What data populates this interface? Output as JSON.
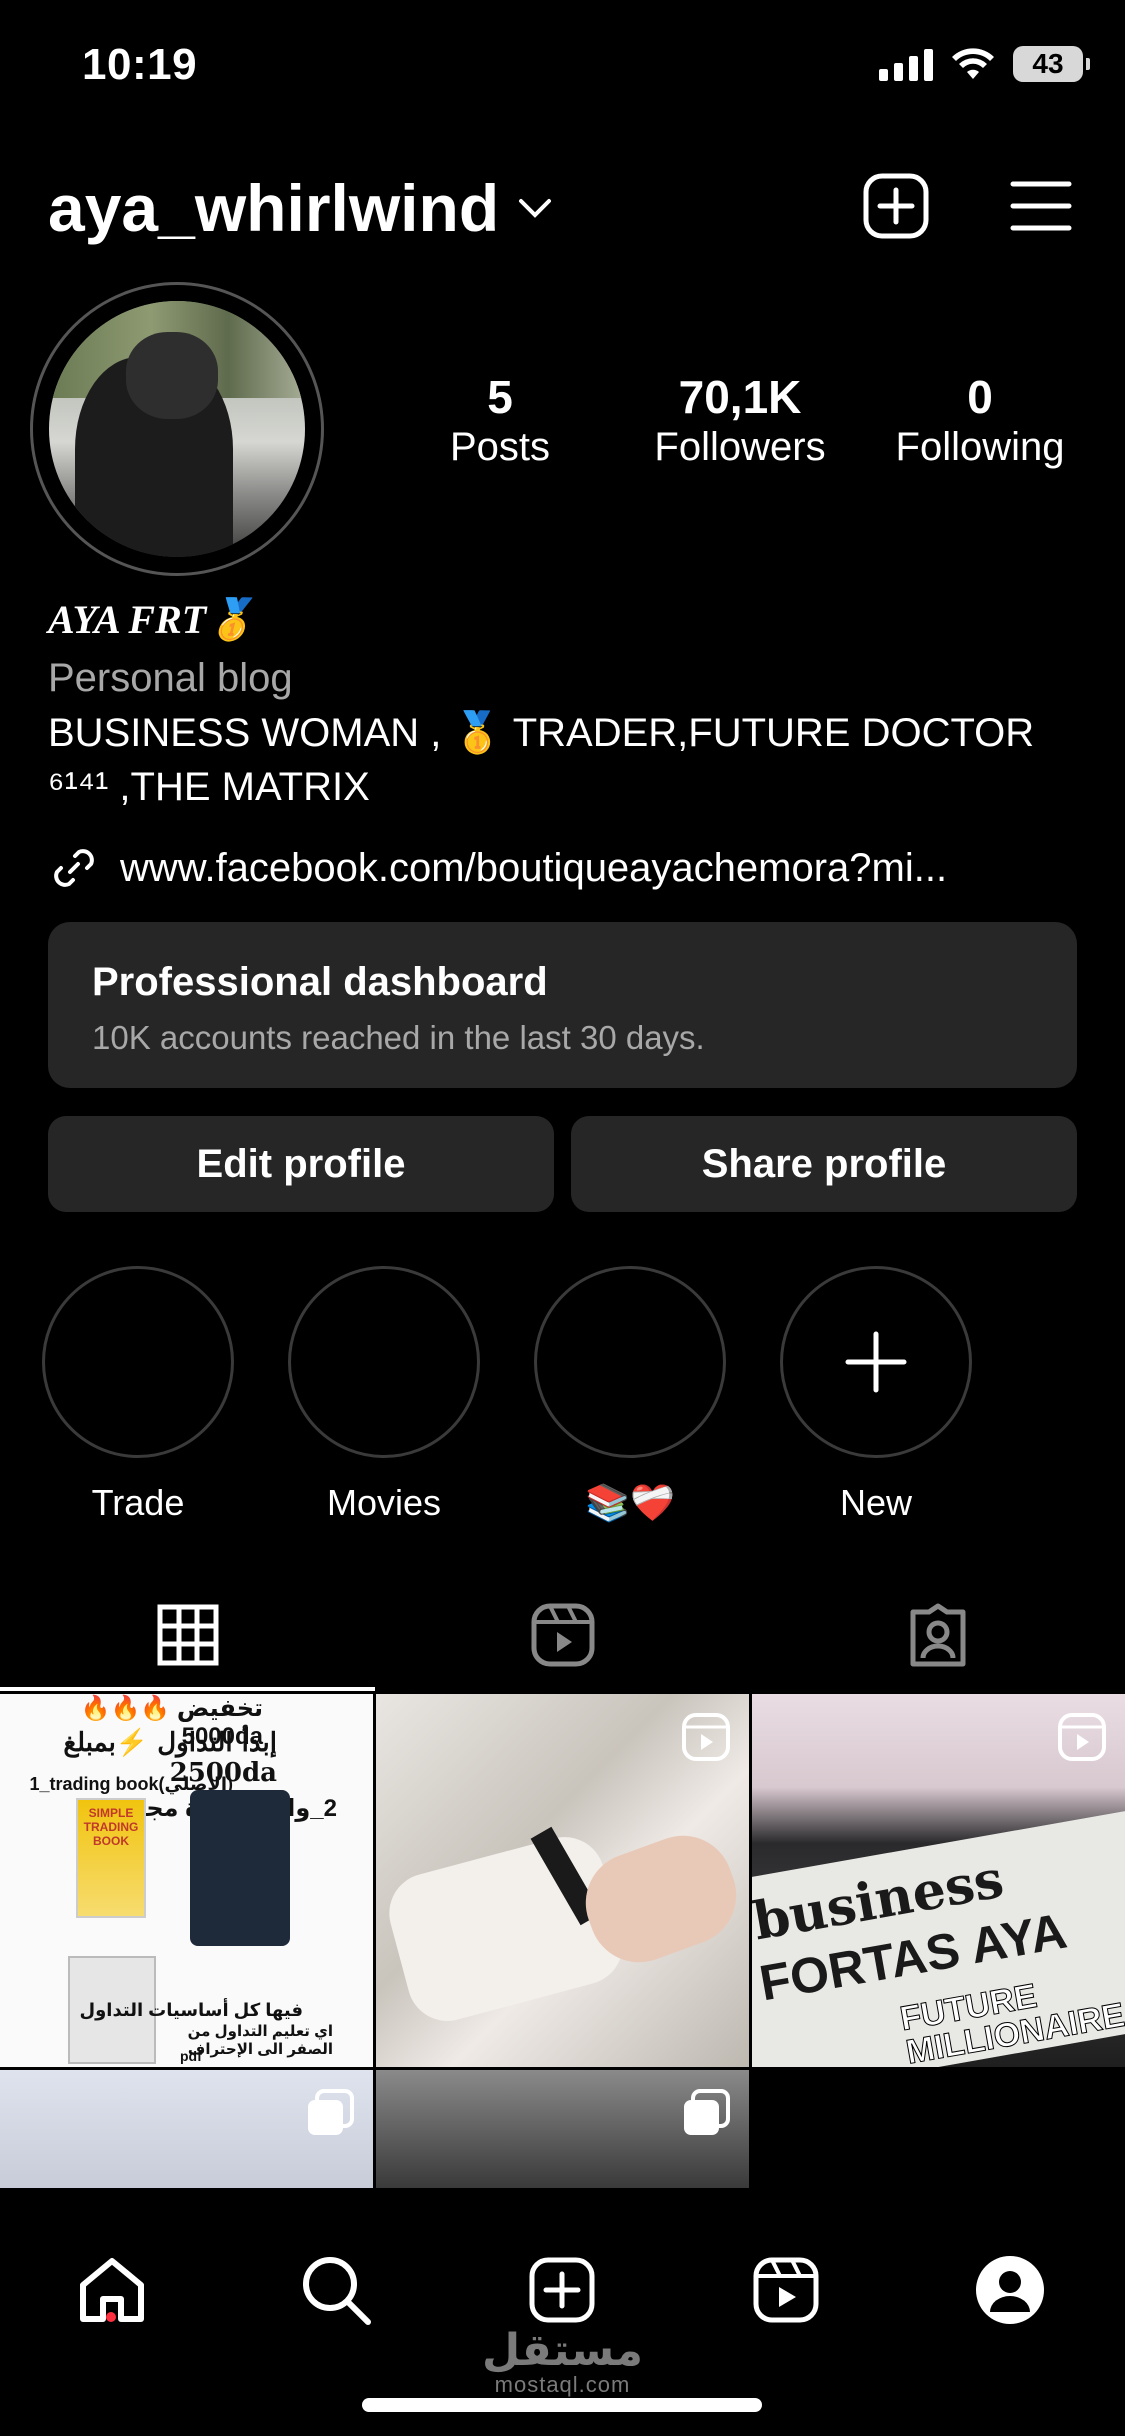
{
  "status_bar": {
    "time": "10:19",
    "battery": "43"
  },
  "header": {
    "username": "aya_whirlwind"
  },
  "stats": [
    {
      "value": "5",
      "label": "Posts"
    },
    {
      "value": "70,1K",
      "label": "Followers"
    },
    {
      "value": "0",
      "label": "Following"
    }
  ],
  "bio": {
    "name": "AYA FRT🥇",
    "category": "Personal blog",
    "line1": "BUSINESS WOMAN , 🥇 TRADER,FUTURE DOCTOR",
    "line2": "⁶¹⁴¹ ,THE MATRIX",
    "link": "www.facebook.com/boutiqueayachemora?mi..."
  },
  "dashboard": {
    "title": "Professional dashboard",
    "subtitle": "10K accounts reached in the last 30 days."
  },
  "buttons": {
    "edit": "Edit profile",
    "share": "Share profile"
  },
  "highlights": [
    {
      "label": "Trade"
    },
    {
      "label": "Movies"
    },
    {
      "label": "📚❤️‍🩹"
    },
    {
      "label": "New"
    }
  ],
  "posts": {
    "p1": {
      "line1": "تخفيض 🔥🔥🔥 5000da",
      "line2": "إبدأ التداول ⚡بمبلغ 2500da",
      "line3": "1_trading book(الأصلي)",
      "line4": "2_واربح دورة مجانية",
      "book": "SIMPLE TRADING BOOK",
      "line5": "فيها كل أساسيات التداول",
      "line6": "اي تعليم التداول من الصفر الى الإحتراف",
      "line7": "pdf"
    },
    "p3": {
      "line1": "business",
      "line2": "FORTAS AYA",
      "line3": "FUTURE MILLIONAIRE"
    }
  },
  "watermark": {
    "arabic": "مستقل",
    "latin": "mostaql.com"
  },
  "colors": {
    "background": "#000000",
    "surface": "#262626",
    "muted_text": "#a8a8a8",
    "notification": "#ff3040"
  }
}
